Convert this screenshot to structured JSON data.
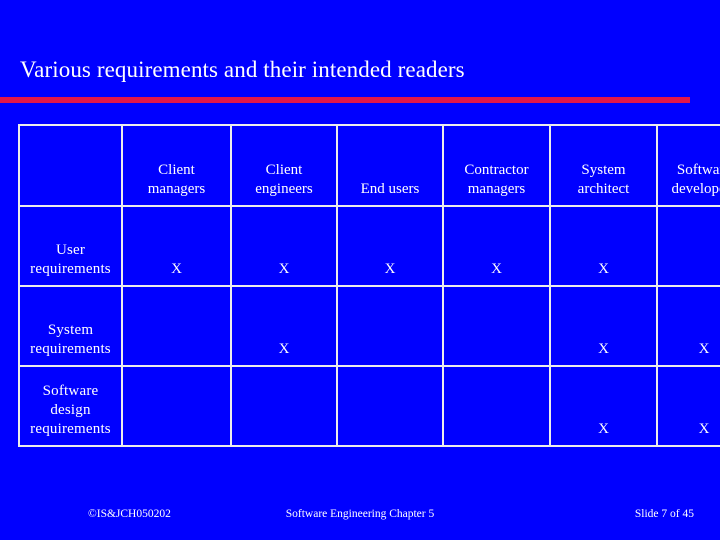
{
  "slide": {
    "title": "Various requirements and their intended readers",
    "accent_color": "#e2164a",
    "background_color": "#0000ff",
    "text_color": "#ffffff",
    "border_color": "#ececec"
  },
  "table": {
    "corner_label": "",
    "column_headers": [
      {
        "line1": "Client",
        "line2": "managers"
      },
      {
        "line1": "Client",
        "line2": "engineers"
      },
      {
        "line1": "",
        "line2": "End users"
      },
      {
        "line1": "Contractor",
        "line2": "managers"
      },
      {
        "line1": "System",
        "line2": "architect"
      },
      {
        "line1": "Software",
        "line2": "developers"
      }
    ],
    "mark": "X",
    "rows": [
      {
        "label_lines": [
          "User",
          "requirements"
        ],
        "cells": [
          "X",
          "X",
          "X",
          "X",
          "X",
          ""
        ]
      },
      {
        "label_lines": [
          "System",
          "requirements"
        ],
        "cells": [
          "",
          "X",
          "",
          "",
          "X",
          "X"
        ]
      },
      {
        "label_lines": [
          "Software",
          "design",
          "requirements"
        ],
        "cells": [
          "",
          "",
          "",
          "",
          "X",
          "X"
        ]
      }
    ]
  },
  "footer": {
    "left": "©IS&JCH050202",
    "center": "Software Engineering Chapter 5",
    "right": "Slide  7 of 45"
  }
}
